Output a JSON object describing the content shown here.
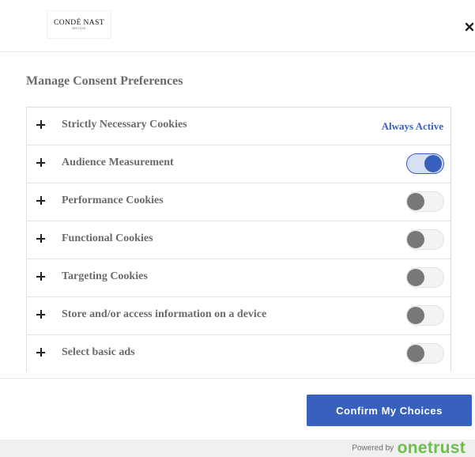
{
  "header": {
    "logo_text": "CONDÉ NAST",
    "logo_subtext": "BRITAIN",
    "close_icon": "close-icon"
  },
  "title": "Manage Consent Preferences",
  "categories": [
    {
      "label": "Strictly Necessary Cookies",
      "status": "Always Active"
    },
    {
      "label": "Audience Measurement",
      "enabled": true
    },
    {
      "label": "Performance Cookies",
      "enabled": false
    },
    {
      "label": "Functional Cookies",
      "enabled": false
    },
    {
      "label": "Targeting Cookies",
      "enabled": false
    },
    {
      "label": "Store and/or access information on a device",
      "enabled": false
    },
    {
      "label": "Select basic ads",
      "enabled": false
    }
  ],
  "footer": {
    "confirm_label": "Confirm My Choices",
    "powered_by": "Powered by",
    "brand": "onetrust"
  },
  "colors": {
    "accent": "#3860be",
    "toggle_off": "#787878",
    "brand_green": "#6cc04a"
  }
}
